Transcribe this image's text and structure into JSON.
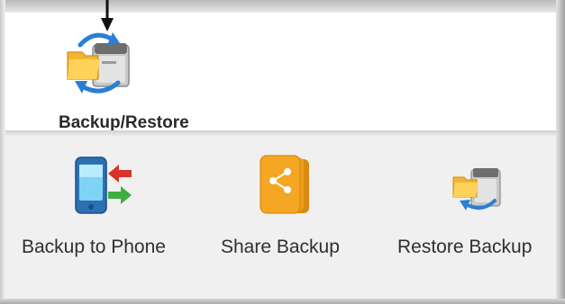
{
  "top": {
    "backup_restore_label": "Backup/Restore"
  },
  "actions": [
    {
      "label": "Backup to Phone",
      "icon": "phone-transfer-icon"
    },
    {
      "label": "Share Backup",
      "icon": "share-backup-icon"
    },
    {
      "label": "Restore Backup",
      "icon": "restore-backup-icon"
    }
  ],
  "colors": {
    "top_panel_bg": "#ffffff",
    "bottom_panel_bg": "#f0f0f0",
    "label_text": "#2f2f2f",
    "share_icon_orange": "#f5a623",
    "sync_arrow_blue": "#2a7fd4",
    "folder_yellow": "#f7c948"
  }
}
